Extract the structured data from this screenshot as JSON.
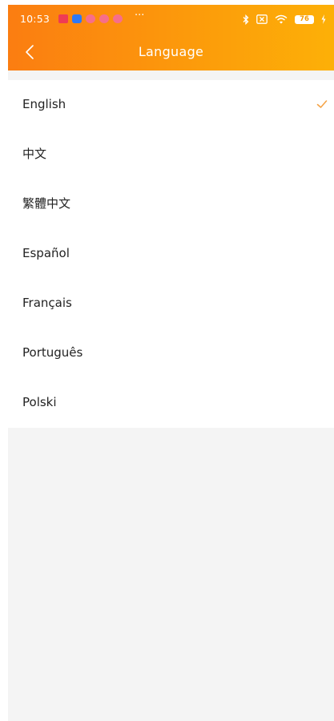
{
  "status_bar": {
    "time": "10:53",
    "notification_icons": [
      "mi-notification-icon",
      "app-notification-icon",
      "cat-notification-icon",
      "cat-notification-icon",
      "cat-notification-icon"
    ],
    "more": "···",
    "battery_level": "76",
    "icons": [
      "bluetooth-icon",
      "sim-card-icon",
      "wifi-icon",
      "battery-icon",
      "charging-icon"
    ]
  },
  "nav": {
    "title": "Language",
    "back_icon": "chevron-left-icon"
  },
  "languages": [
    {
      "label": "English",
      "selected": true
    },
    {
      "label": "中文",
      "selected": false
    },
    {
      "label": "繁體中文",
      "selected": false
    },
    {
      "label": "Español",
      "selected": false
    },
    {
      "label": "Français",
      "selected": false
    },
    {
      "label": "Português",
      "selected": false
    },
    {
      "label": "Polski",
      "selected": false
    }
  ],
  "colors": {
    "header_start": "#fb7d11",
    "header_end": "#fdb007",
    "check": "#f5a142",
    "background": "#f4f4f4"
  }
}
